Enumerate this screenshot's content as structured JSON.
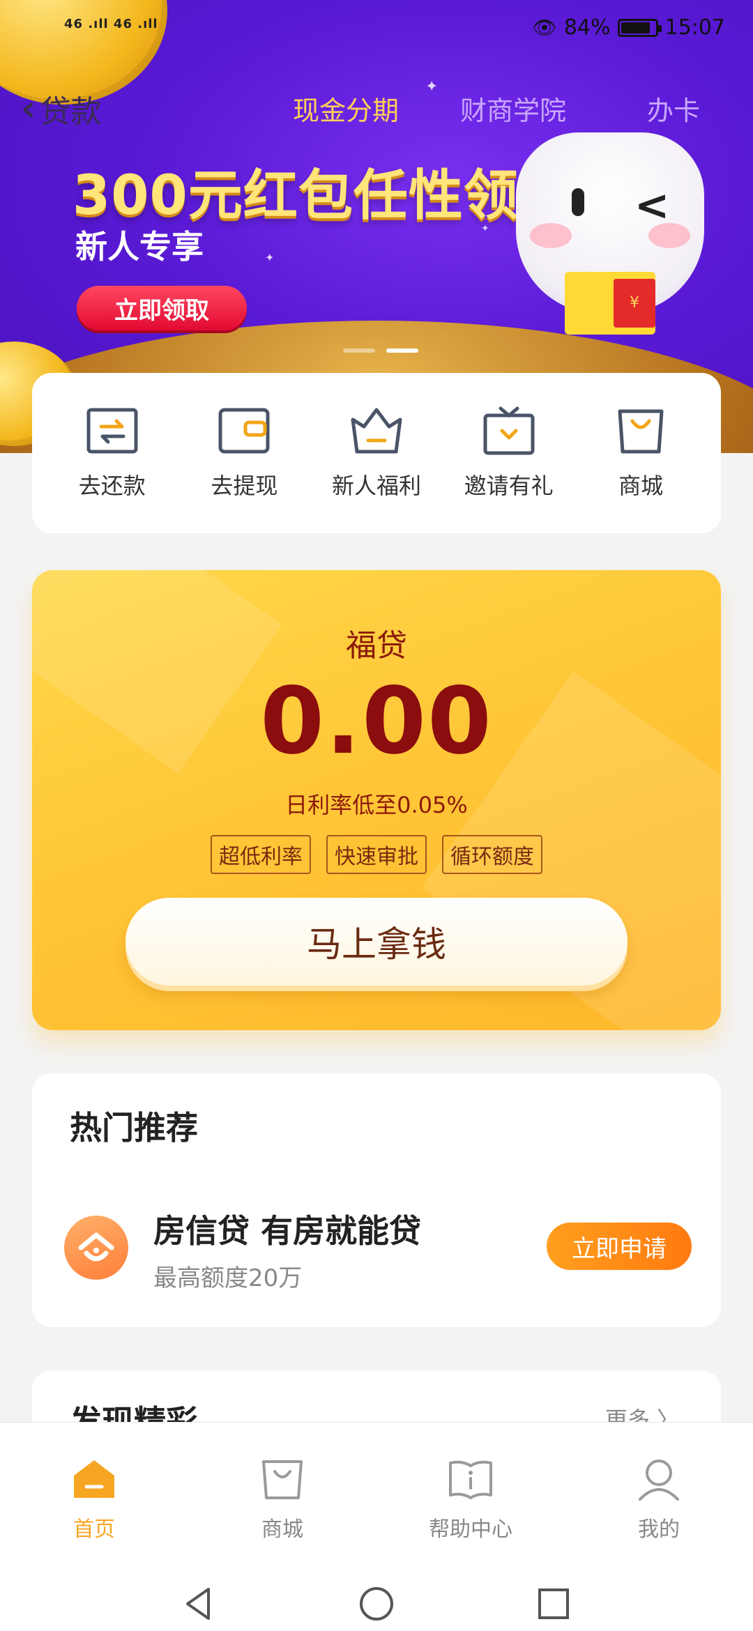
{
  "status_bar": {
    "signal": "46 .ıll 46 .ıll",
    "battery": "84%",
    "time": "15:07"
  },
  "nav": {
    "back_label": "贷款",
    "tabs": [
      {
        "label": "现金分期",
        "active": true
      },
      {
        "label": "财商学院",
        "active": false
      },
      {
        "label": "办卡",
        "active": false
      }
    ]
  },
  "banner": {
    "title": "300元红包任性领",
    "subtitle": "新人专享",
    "button": "立即领取",
    "envelope_symbol": "¥",
    "slides": 2,
    "active_slide": 1
  },
  "quick_actions": [
    {
      "icon": "repay-icon",
      "label": "去还款"
    },
    {
      "icon": "wallet-icon",
      "label": "去提现"
    },
    {
      "icon": "crown-icon",
      "label": "新人福利"
    },
    {
      "icon": "gift-icon",
      "label": "邀请有礼"
    },
    {
      "icon": "shopping-bag-icon",
      "label": "商城"
    }
  ],
  "loan_card": {
    "name": "福贷",
    "amount": "0.00",
    "rate_text": "日利率低至0.05%",
    "tags": [
      "超低利率",
      "快速审批",
      "循环额度"
    ],
    "cta": "马上拿钱"
  },
  "hot": {
    "title": "热门推荐",
    "item": {
      "icon": "house-loan-icon",
      "name": "房信贷 有房就能贷",
      "desc": "最高额度20万",
      "button": "立即申请"
    }
  },
  "discover": {
    "title": "发现精彩",
    "more": "更多 〉"
  },
  "tabbar": [
    {
      "icon": "home-icon",
      "label": "首页",
      "active": true
    },
    {
      "icon": "shopping-bag-icon",
      "label": "商城",
      "active": false
    },
    {
      "icon": "help-book-icon",
      "label": "帮助中心",
      "active": false
    },
    {
      "icon": "user-icon",
      "label": "我的",
      "active": false
    }
  ],
  "colors": {
    "accent": "#f6a623",
    "hero_purple": "#5a1ad6",
    "loan_red": "#8b0d0d",
    "apply_orange": "#ff8a16"
  }
}
